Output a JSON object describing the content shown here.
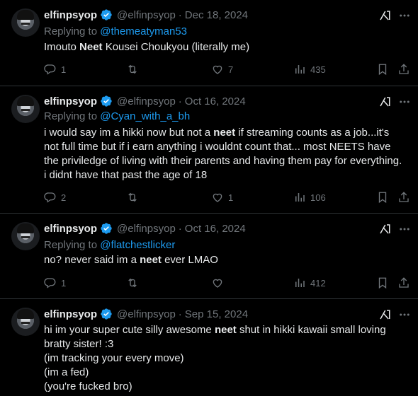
{
  "colors": {
    "background": "#000000",
    "text": "#e7e9ea",
    "muted": "#71767b",
    "link": "#1d9bf0",
    "verified": "#1d9bf0",
    "divider": "#2f3336"
  },
  "tweets": [
    {
      "name": "elfinpsyop",
      "handle": "@elfinpsyop",
      "date": "Dec 18, 2024",
      "replying_label": "Replying to",
      "replying_to": "@themeatyman53",
      "text_parts": [
        "Imouto ",
        "Neet",
        " Kousei Choukyou (literally me)"
      ],
      "replies": "1",
      "reposts": "",
      "likes": "7",
      "views": "435"
    },
    {
      "name": "elfinpsyop",
      "handle": "@elfinpsyop",
      "date": "Oct 16, 2024",
      "replying_label": "Replying to",
      "replying_to": "@Cyan_with_a_bh",
      "text_parts": [
        "i would say im a hikki now but not a ",
        "neet",
        " if streaming counts as a job...it's not full time but if i earn anything i wouldnt count that... most NEETS have the priviledge of living with their parents and having them pay for everything. i didnt have that past the age of 18"
      ],
      "replies": "2",
      "reposts": "",
      "likes": "1",
      "views": "106"
    },
    {
      "name": "elfinpsyop",
      "handle": "@elfinpsyop",
      "date": "Oct 16, 2024",
      "replying_label": "Replying to",
      "replying_to": "@flatchestlicker",
      "text_parts": [
        "no? never said im a ",
        "neet",
        " ever LMAO"
      ],
      "replies": "1",
      "reposts": "",
      "likes": "",
      "views": "412"
    },
    {
      "name": "elfinpsyop",
      "handle": "@elfinpsyop",
      "date": "Sep 15, 2024",
      "text_parts": [
        "hi im your super cute silly awesome ",
        "neet",
        " shut in hikki kawaii small loving bratty sister! :3"
      ],
      "extra_lines": [
        "(im tracking your every move)",
        "(im a fed)",
        "(you're fucked bro)"
      ]
    }
  ],
  "separator": "·"
}
